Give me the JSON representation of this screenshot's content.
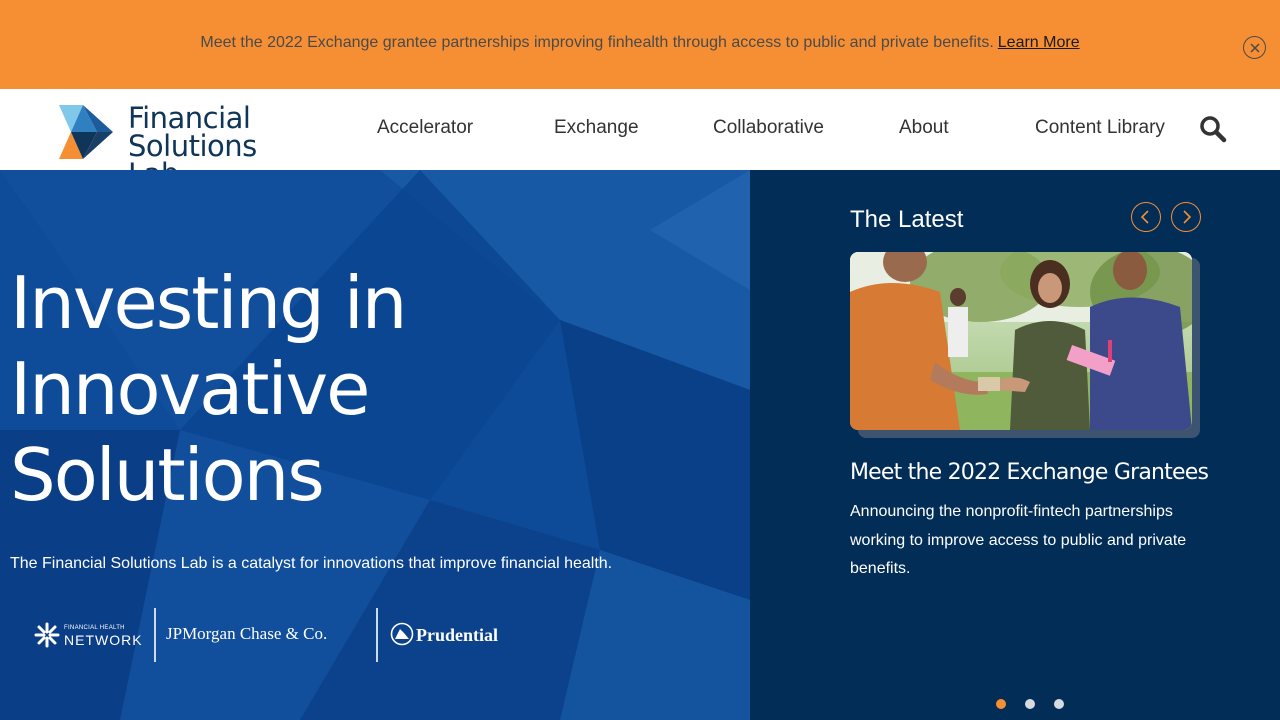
{
  "banner": {
    "message": "Meet the 2022 Exchange grantee partnerships improving finhealth through access to public and private benefits.",
    "link_label": "Learn More",
    "close_icon": "close-circle-icon"
  },
  "header": {
    "logo_line1": "Financial",
    "logo_line2": "Solutions Lab",
    "nav": [
      "Accelerator",
      "Exchange",
      "Collaborative",
      "About",
      "Content Library"
    ],
    "search_icon": "search-icon"
  },
  "hero": {
    "title_lines": [
      "Investing in",
      "Innovative",
      "Solutions"
    ],
    "subtitle": "The Financial Solutions Lab is a catalyst for innovations that improve financial health.",
    "partners": {
      "fhn_small": "FINANCIAL HEALTH",
      "fhn_big": "NETWORK",
      "jpm": "JPMorgan Chase & Co.",
      "prudential": "Prudential"
    }
  },
  "latest": {
    "heading": "The Latest",
    "prev_icon": "chevron-left-icon",
    "next_icon": "chevron-right-icon",
    "card": {
      "title": "Meet the 2022 Exchange Grantees",
      "description": "Announcing the nonprofit-fintech partnerships working to improve access to public and private benefits."
    },
    "slides": 3,
    "active_slide": 1
  },
  "colors": {
    "banner": "#f68f33",
    "navy": "#022d56",
    "hero_blue": "#0d4a97",
    "accent": "#f68f33"
  }
}
